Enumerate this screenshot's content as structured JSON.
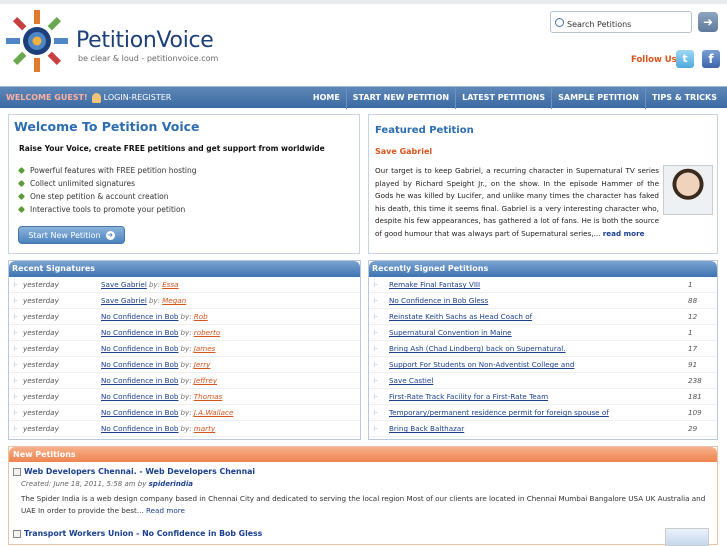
{
  "header": {
    "brand": "PetitionVoice",
    "tagline": "be clear & loud - petitionvoice.com",
    "search_placeholder": "Search Petitions",
    "follow_label": "Follow Us"
  },
  "nav": {
    "welcome": "WELCOME GUEST!",
    "login": "LOGIN-REGISTER",
    "links": [
      "HOME",
      "START NEW PETITION",
      "LATEST PETITIONS",
      "SAMPLE PETITION",
      "TIPS & TRICKS"
    ]
  },
  "welcome": {
    "title": "Welcome To Petition Voice",
    "subtitle": "Raise Your Voice, create FREE petitions and get support from worldwide",
    "features": [
      "Powerful features with FREE petition hosting",
      "Collect unlimited signatures",
      "One step petition & account creation",
      "Interactive tools to promote your petition"
    ],
    "button": "Start New Petition"
  },
  "featured": {
    "heading": "Featured Petition",
    "title": "Save Gabriel",
    "description": "Our target is to keep Gabriel, a recurring character in Supernatural TV series played by Richard Speight Jr., on the show. In the episode Hammer of the Gods he was killed by Lucifer, and unlike many times the character has faked his death, this time it seems final. Gabriel is a very interesting character who, despite his few appearances, has gathered a lot of fans. He is both the source of good humour that was always part of Supernatural series,...",
    "read_more": "read more"
  },
  "recent_signatures": {
    "heading": "Recent Signatures",
    "by_label": "by:",
    "rows": [
      {
        "when": "yesterday",
        "petition": "Save Gabriel",
        "name": "Essa"
      },
      {
        "when": "yesterday",
        "petition": "Save Gabriel",
        "name": "Megan"
      },
      {
        "when": "yesterday",
        "petition": "No Confidence in Bob",
        "name": "Rob"
      },
      {
        "when": "yesterday",
        "petition": "No Confidence in Bob",
        "name": "roberto"
      },
      {
        "when": "yesterday",
        "petition": "No Confidence in Bob",
        "name": "James"
      },
      {
        "when": "yesterday",
        "petition": "No Confidence in Bob",
        "name": "Jerry"
      },
      {
        "when": "yesterday",
        "petition": "No Confidence in Bob",
        "name": "Jeffrey"
      },
      {
        "when": "yesterday",
        "petition": "No Confidence in Bob",
        "name": "Thomas"
      },
      {
        "when": "yesterday",
        "petition": "No Confidence in Bob",
        "name": "J.A.Wallace"
      },
      {
        "when": "yesterday",
        "petition": "No Confidence in Bob",
        "name": "marty"
      }
    ]
  },
  "recently_signed": {
    "heading": "Recently Signed Petitions",
    "rows": [
      {
        "petition": "Remake Final Fantasy VIII",
        "count": "1"
      },
      {
        "petition": "No Confidence in Bob Gless",
        "count": "88"
      },
      {
        "petition": "Reinstate Keith Sachs as Head Coach of",
        "count": "12"
      },
      {
        "petition": "Supernatural Convention in Maine",
        "count": "1"
      },
      {
        "petition": "Bring Ash (Chad Lindberg) back on Supernatural.",
        "count": "17"
      },
      {
        "petition": "Support For Students on Non-Adventist College and",
        "count": "91"
      },
      {
        "petition": "Save Castiel",
        "count": "238"
      },
      {
        "petition": "First-Rate Track Facility for a First-Rate Team",
        "count": "181"
      },
      {
        "petition": "Temporary/permanent residence permit for foreign spouse of",
        "count": "109"
      },
      {
        "petition": "Bring Back Balthazar",
        "count": "29"
      }
    ]
  },
  "new_petitions": {
    "heading": "New Petitions",
    "items": [
      {
        "title": "Web Developers Chennai. - Web Developers Chennai",
        "created": "Created: June 18, 2011, 5:58 am by",
        "author": "spiderindia",
        "description": "The Spider India is a web design company based in Chennai City and dedicated to serving the local region Most of our clients are located in Chennai Mumbai Bangalore USA UK Australia and UAE In order to provide the best...",
        "read_more": "Read more"
      },
      {
        "title": "Transport Workers Union - No Confidence in Bob Gless"
      }
    ]
  }
}
